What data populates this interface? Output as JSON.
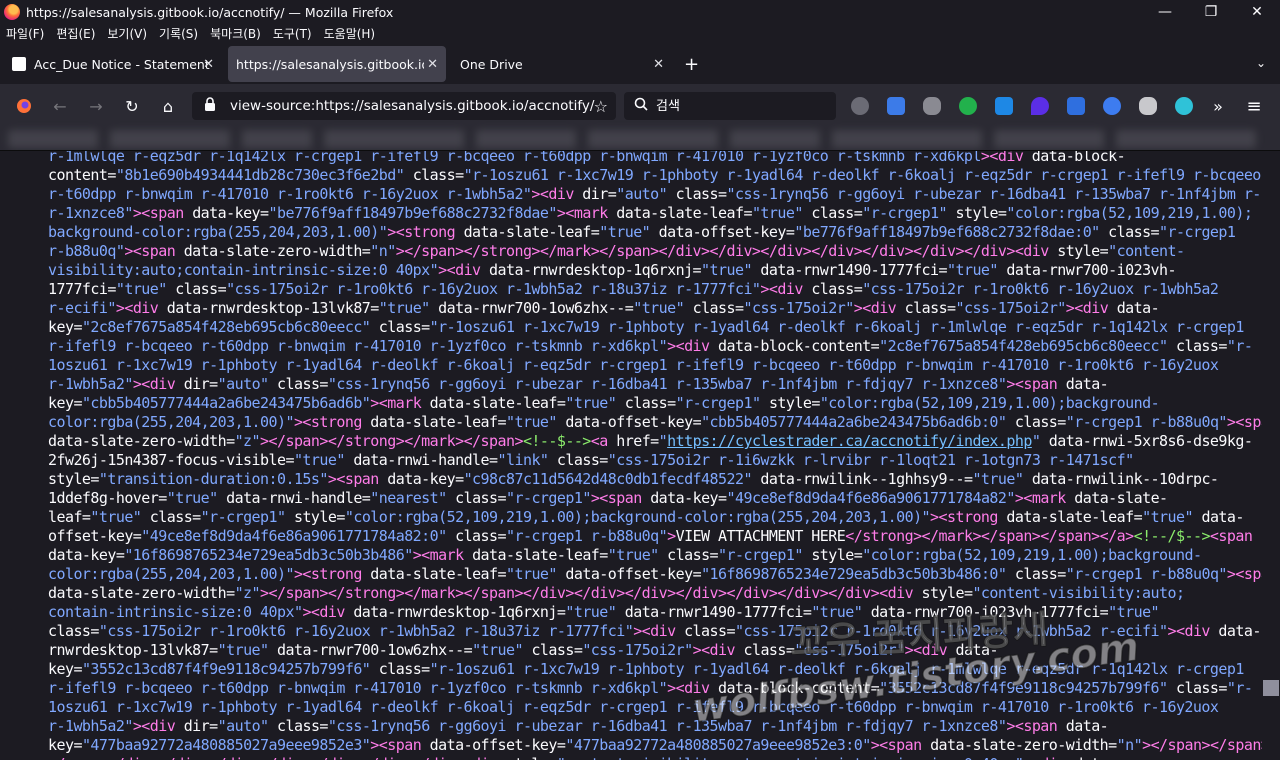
{
  "window": {
    "title": "https://salesanalysis.gitbook.io/accnotify/ — Mozilla Firefox",
    "minimize": "—",
    "maximize": "❐",
    "close": "✕"
  },
  "menu": [
    "파일(F)",
    "편집(E)",
    "보기(V)",
    "기록(S)",
    "북마크(B)",
    "도구(T)",
    "도움말(H)"
  ],
  "tabs": [
    {
      "label": "Acc_Due Notice - Statement",
      "close": "✕"
    },
    {
      "label": "https://salesanalysis.gitbook.io/acc",
      "close": "✕"
    },
    {
      "label": "One Drive",
      "close": "✕"
    }
  ],
  "new_tab": "+",
  "tab_list": "⌄",
  "nav": {
    "back": "←",
    "forward": "→",
    "reload": "↻",
    "home": "⌂",
    "url": "view-source:https://salesanalysis.gitbook.io/accnotify/",
    "bookmark_star": "☆",
    "search_placeholder": "검색",
    "overflow": "»",
    "menu": "≡"
  },
  "extension_icons": [
    "shield-icon",
    "translate-icon",
    "puzzle-icon",
    "n-icon",
    "blue-shield-icon",
    "gem-icon",
    "ublock-icon",
    "check-circle-icon",
    "database-icon",
    "chat-icon"
  ],
  "colors": {
    "tag": "#ff7de9",
    "attr_value": "#80a8ff",
    "comment": "#8bec6c",
    "link": "#75bfff"
  },
  "link_href": "https://cyclestrader.ca/accnotify/index.php",
  "watermark": {
    "line1": "꼬우 꿈지파랑새",
    "line2": "wolfbsw.tistory.com"
  }
}
